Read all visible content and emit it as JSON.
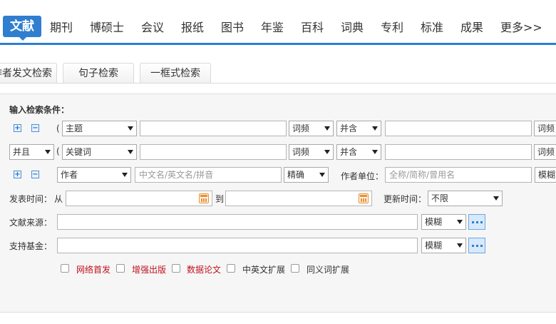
{
  "nav": {
    "items": [
      "文献",
      "期刊",
      "博硕士",
      "会议",
      "报纸",
      "图书",
      "年鉴",
      "百科",
      "词典",
      "专利",
      "标准",
      "成果",
      "更多>>"
    ]
  },
  "tabs": [
    "作者发文检索",
    "句子检索",
    "一框式检索"
  ],
  "form": {
    "title": "输入检索条件：",
    "row1": {
      "paren": "(",
      "field": "主题",
      "freq": "词频",
      "combine": "并含",
      "freq2": "词频"
    },
    "row2": {
      "logic": "并且",
      "paren": "(",
      "field": "关键词",
      "freq": "词频",
      "combine": "并含",
      "freq2": "词频"
    },
    "row3": {
      "field": "作者",
      "placeholder": "中文名/英文名/拼音",
      "match": "精确",
      "unit_label": "作者单位：",
      "unit_placeholder": "全称/简称/曾用名",
      "unit_match": "模糊"
    },
    "date": {
      "label": "发表时间：",
      "from": "从",
      "to": "到",
      "update_label": "更新时间：",
      "update_value": "不限"
    },
    "source": {
      "label": "文献来源：",
      "match": "模糊"
    },
    "fund": {
      "label": "支持基金：",
      "match": "模糊"
    },
    "plus": "+",
    "minus": "−",
    "checkboxes": [
      "网络首发",
      "增强出版",
      "数据论文",
      "中英文扩展",
      "同义词扩展"
    ]
  },
  "colors": {
    "accent": "#2f7ecf",
    "highlight_text": "#c0121e",
    "calendar": "#e69035"
  },
  "icons": [
    "plus-square-icon",
    "minus-square-icon",
    "calendar-icon",
    "more-dots-icon",
    "dropdown-arrow-icon"
  ]
}
